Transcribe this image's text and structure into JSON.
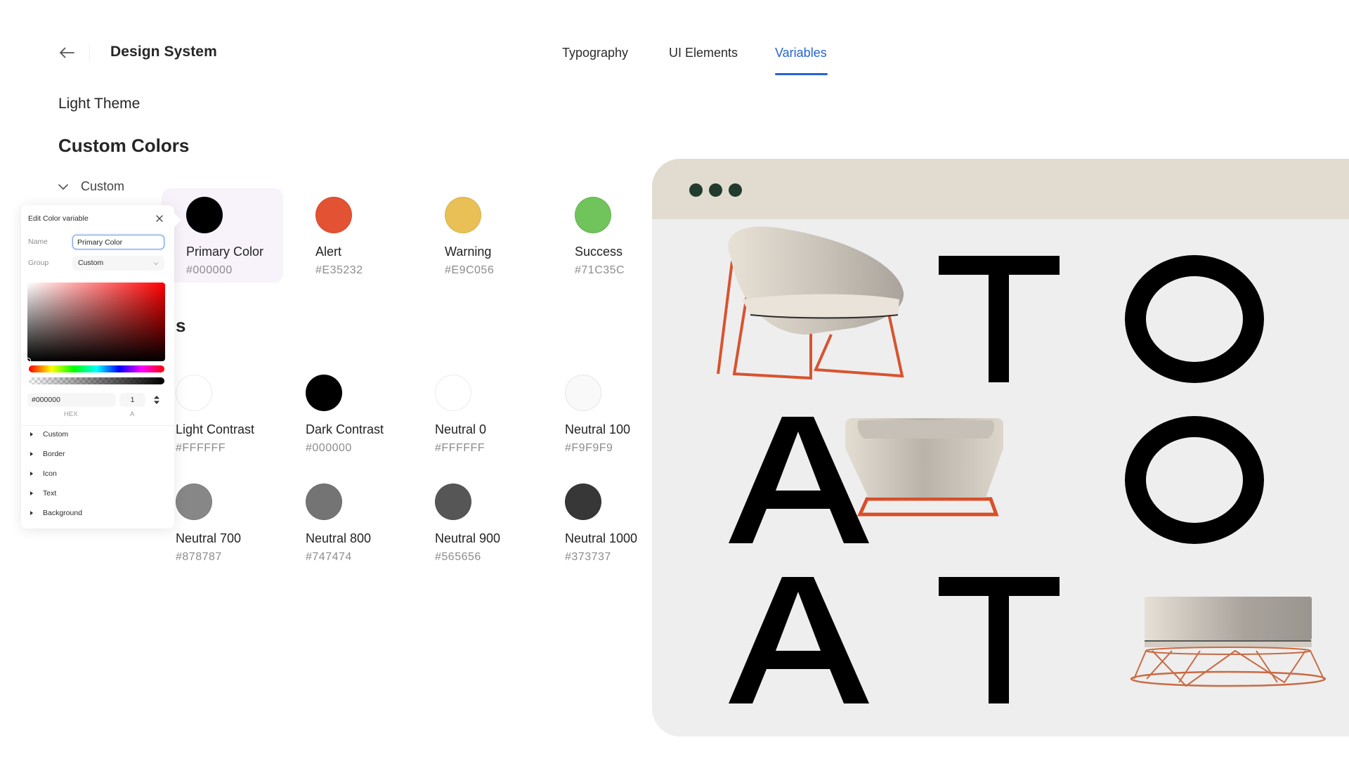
{
  "header": {
    "back_icon": "arrow-left-icon",
    "title": "Design System"
  },
  "tabs": [
    {
      "label": "Typography",
      "active": false
    },
    {
      "label": "UI Elements",
      "active": false
    },
    {
      "label": "Variables",
      "active": true
    }
  ],
  "accent_color": "#2563D8",
  "theme_title": "Light Theme",
  "section_title": "Custom Colors",
  "group": {
    "label": "Custom",
    "expanded": true,
    "icon": "chevron-down-icon"
  },
  "partial_heading": "s",
  "custom_swatches": [
    {
      "name": "Primary Color",
      "hex": "#000000",
      "selected": true
    },
    {
      "name": "Alert",
      "hex": "#E35232"
    },
    {
      "name": "Warning",
      "hex": "#E9C056"
    },
    {
      "name": "Success",
      "hex": "#71C35C"
    }
  ],
  "system_swatches": [
    {
      "name": "Light Contrast",
      "hex": "#FFFFFF"
    },
    {
      "name": "Dark Contrast",
      "hex": "#000000"
    },
    {
      "name": "Neutral 0",
      "hex": "#FFFFFF"
    },
    {
      "name": "Neutral 100",
      "hex": "#F9F9F9"
    },
    {
      "name": "Neutral 700",
      "hex": "#878787"
    },
    {
      "name": "Neutral 800",
      "hex": "#747474"
    },
    {
      "name": "Neutral 900",
      "hex": "#565656"
    },
    {
      "name": "Neutral 1000",
      "hex": "#373737"
    }
  ],
  "popup": {
    "title": "Edit Color variable",
    "close_icon": "close-icon",
    "name_label": "Name",
    "name_value": "Primary Color",
    "group_label": "Group",
    "group_value": "Custom",
    "hex_value": "#000000",
    "alpha_value": "1",
    "hex_caption": "HEX",
    "alpha_caption": "A",
    "picker_hue": "#FF0000",
    "tree_items": [
      "Custom",
      "Border",
      "Icon",
      "Text",
      "Background"
    ]
  },
  "preview": {
    "bar_color": "#E2DCD0",
    "dot_color": "#223B2F",
    "canvas_color": "#EEEEEE",
    "letters": [
      "T",
      "O",
      "A",
      "O",
      "A",
      "T"
    ],
    "furniture": [
      "lounge-chair",
      "sofa",
      "ottoman"
    ]
  }
}
